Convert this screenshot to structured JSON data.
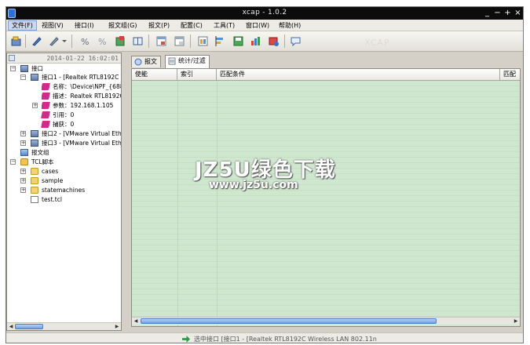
{
  "window": {
    "title": "xcap - 1.0.2"
  },
  "window_buttons": [
    "_",
    "−",
    "+",
    "×"
  ],
  "menu": [
    "文件(F)",
    "视图(V)",
    "接口(I)",
    "报文组(G)",
    "报文(P)",
    "配置(C)",
    "工具(T)",
    "窗口(W)",
    "帮助(H)"
  ],
  "toolbar": {
    "ghost_text": "XCAP"
  },
  "left_panel": {
    "timestamp": "2014-01-22 16:02:01",
    "tree": [
      {
        "label": "接口",
        "icon": "nic-icon",
        "expander": "−"
      },
      {
        "label": "接口1 - [Realtek RTL8192C V",
        "icon": "nic-icon",
        "expander": "−"
      },
      {
        "label": "名称：\\Device\\NPF_{688",
        "icon": "property-icon",
        "expander": ""
      },
      {
        "label": "描述：Realtek RTL8192C",
        "icon": "property-icon",
        "expander": ""
      },
      {
        "label": "参数：192.168.1.105",
        "icon": "property-icon",
        "expander": "+"
      },
      {
        "label": "引用：0",
        "icon": "property-icon",
        "expander": ""
      },
      {
        "label": "捕获：0",
        "icon": "property-icon",
        "expander": ""
      },
      {
        "label": "接口2 - [VMware Virtual Ethe",
        "icon": "nic-icon",
        "expander": "+"
      },
      {
        "label": "接口3 - [VMware Virtual Ethe",
        "icon": "nic-icon",
        "expander": "+"
      },
      {
        "label": "报文组",
        "icon": "packet-group-icon",
        "expander": ""
      },
      {
        "label": "TCL脚本",
        "icon": "tcl-script-icon",
        "expander": "−"
      },
      {
        "label": "cases",
        "icon": "folder-icon",
        "expander": "+"
      },
      {
        "label": "sample",
        "icon": "folder-icon",
        "expander": "+"
      },
      {
        "label": "statemachines",
        "icon": "folder-icon",
        "expander": "+"
      },
      {
        "label": "test.tcl",
        "icon": "file-icon",
        "expander": ""
      }
    ]
  },
  "right_panel": {
    "tabs": [
      {
        "label": "报文",
        "active": false
      },
      {
        "label": "统计/过滤",
        "active": true
      }
    ],
    "columns": [
      "使能",
      "索引",
      "匹配条件",
      "匹配"
    ]
  },
  "status": {
    "text": "选中接口 [接口1 - [Realtek RTL8192C Wireless LAN 802.11n"
  },
  "watermark": {
    "main": "JZ5U绿色下载",
    "sub": "www.jz5u.com"
  },
  "colors": {
    "titlebar": "#0c0c0c",
    "grid_bg": "#cfe7cf",
    "chrome": "#d4d0c8",
    "accent": "#4d7fc9"
  }
}
